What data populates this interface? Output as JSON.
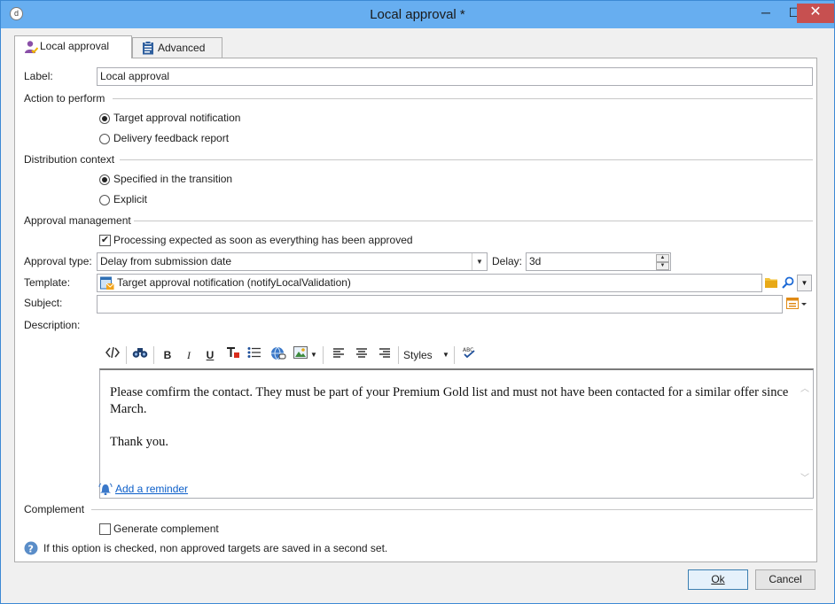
{
  "window": {
    "title": "Local approval *",
    "app_icon": "app-icon",
    "controls": {
      "minimize": "─",
      "maximize": "☐",
      "close": "✕"
    }
  },
  "tabs": [
    {
      "label": "Local approval",
      "icon": "user-approval-icon",
      "active": true
    },
    {
      "label": "Advanced",
      "icon": "clipboard-icon",
      "active": false
    }
  ],
  "form": {
    "label_caption": "Label:",
    "label_value": "Local approval",
    "action_section": "Action to perform",
    "action_options": [
      {
        "label": "Target approval notification",
        "checked": true
      },
      {
        "label": "Delivery feedback report",
        "checked": false
      }
    ],
    "distribution_section": "Distribution context",
    "distribution_options": [
      {
        "label": "Specified in the transition",
        "checked": true
      },
      {
        "label": "Explicit",
        "checked": false
      }
    ],
    "approval_section": "Approval management",
    "processing_checkbox": {
      "label": "Processing expected as soon as everything has been approved",
      "checked": true
    },
    "approval_type_caption": "Approval type:",
    "approval_type_value": "Delay from submission date",
    "delay_caption": "Delay:",
    "delay_value": "3d",
    "template_caption": "Template:",
    "template_value": "Target approval notification (notifyLocalValidation)",
    "subject_caption": "Subject:",
    "subject_value": "",
    "description_caption": "Description:",
    "toolbar": {
      "bold": "B",
      "italic": "I",
      "underline": "U",
      "styles": "Styles"
    },
    "description_lines": [
      "Please comfirm the contact. They must be part of your Premium Gold list and must not have been  contacted for a similar offer since March.",
      "Thank you."
    ],
    "add_reminder_link": "Add a reminder",
    "complement_section": "Complement",
    "generate_complement": {
      "label": "Generate complement",
      "checked": false
    },
    "help_text": "If this option is checked, non approved targets are saved in a second set."
  },
  "buttons": {
    "ok": "Ok",
    "cancel": "Cancel"
  },
  "colors": {
    "titlebar": "#67aef0",
    "close": "#c75050",
    "link": "#0b5ec9"
  }
}
